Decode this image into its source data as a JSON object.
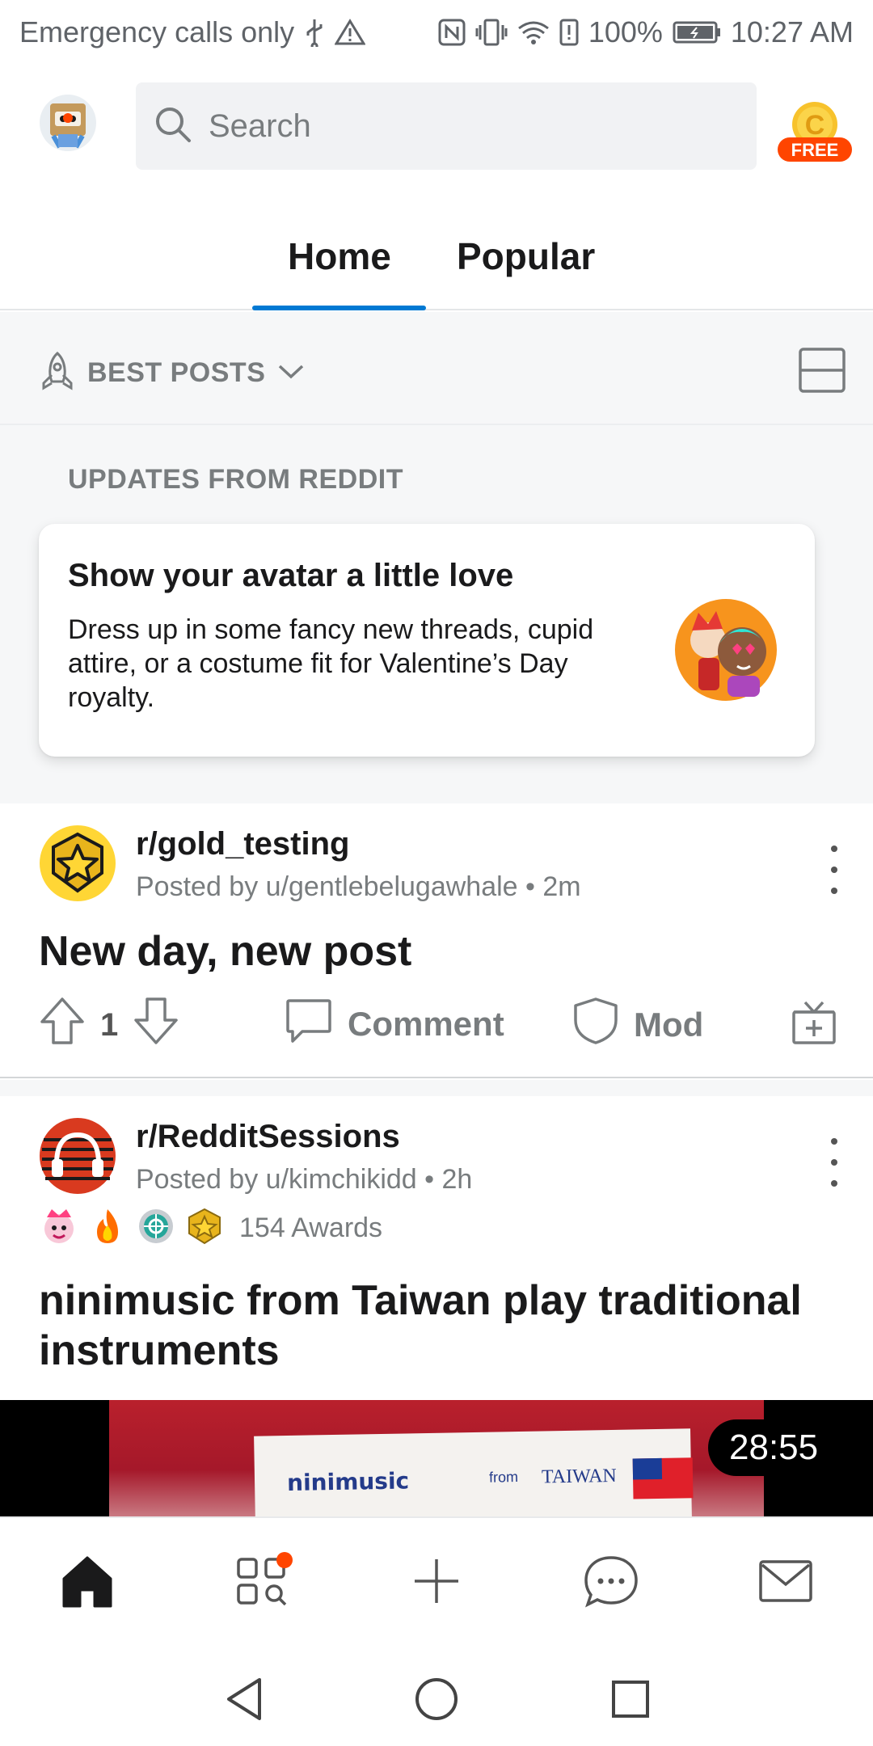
{
  "status_bar": {
    "left_text": "Emergency calls only",
    "battery": "100%",
    "time": "10:27 AM",
    "icons": [
      "usb-icon",
      "warning-icon",
      "nfc-icon",
      "vibrate-icon",
      "wifi-icon",
      "alert-icon",
      "battery-icon"
    ]
  },
  "header": {
    "search_placeholder": "Search",
    "coin_badge": "FREE",
    "coin_letter": "C"
  },
  "tabs": [
    {
      "label": "Home",
      "active": true
    },
    {
      "label": "Popular",
      "active": false
    }
  ],
  "sort": {
    "label": "BEST POSTS"
  },
  "updates": {
    "section_title": "UPDATES FROM REDDIT",
    "card_title": "Show your avatar a little love",
    "card_body": "Dress up in some fancy new threads, cupid attire, or a costume fit for Valentine’s Day royalty."
  },
  "posts": [
    {
      "subreddit": "r/gold_testing",
      "posted_by": "Posted by u/gentlebelugawhale • 2m",
      "title": "New day, new post",
      "votes": "1",
      "comment_label": "Comment",
      "mod_label": "Mod"
    },
    {
      "subreddit": "r/RedditSessions",
      "posted_by": "Posted by u/kimchikidd • 2h",
      "awards_count": "154 Awards",
      "title_line1": "ninimusic from Taiwan play traditional",
      "title_line2": "instruments",
      "banner_brand": "ninimusic",
      "banner_from": "from",
      "banner_country": "TAIWAN",
      "video_duration": "28:55"
    }
  ],
  "colors": {
    "accent_blue": "#0079d3",
    "orangered": "#ff4500",
    "meta_gray": "#787c7e",
    "text": "#1a1a1b"
  }
}
